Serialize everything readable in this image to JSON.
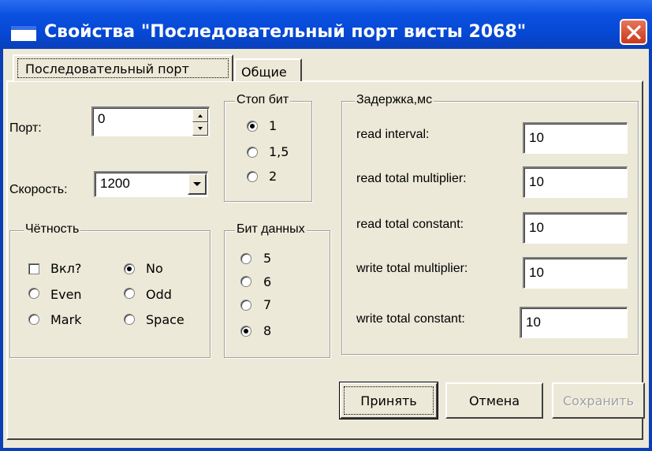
{
  "window": {
    "title": "Свойства  \"Последовательный порт висты 2068\""
  },
  "tabs": [
    {
      "label": "Последовательный порт",
      "active": true
    },
    {
      "label": "Общие",
      "active": false
    }
  ],
  "port": {
    "label": "Порт:",
    "value": "0"
  },
  "speed": {
    "label": "Скорость:",
    "value": "1200"
  },
  "stop_bits": {
    "legend": "Стоп бит",
    "options": [
      "1",
      "1,5",
      "2"
    ],
    "selected": "1"
  },
  "parity": {
    "legend": "Чётность",
    "enable_label": "Вкл?",
    "enabled": false,
    "options": [
      "No",
      "Even",
      "Odd",
      "Mark",
      "Space"
    ],
    "selected": "No"
  },
  "data_bits": {
    "legend": "Бит данных",
    "options": [
      "5",
      "6",
      "7",
      "8"
    ],
    "selected": "8"
  },
  "delay": {
    "legend": "Задержка,мс",
    "fields": [
      {
        "label": "read interval:",
        "value": "10"
      },
      {
        "label": "read total multiplier:",
        "value": "10"
      },
      {
        "label": "read total constant:",
        "value": "10"
      },
      {
        "label": "write total multiplier:",
        "value": "10"
      },
      {
        "label": "write total constant:",
        "value": "10"
      }
    ]
  },
  "buttons": {
    "apply": "Принять",
    "cancel": "Отмена",
    "save": "Сохранить",
    "save_enabled": false
  },
  "icons": {
    "window": "window-icon",
    "close": "close-icon",
    "dropdown": "chevron-down-icon"
  },
  "colors": {
    "titlebar": "#0548d4",
    "face": "#ece9d8",
    "close": "#d9502f"
  }
}
